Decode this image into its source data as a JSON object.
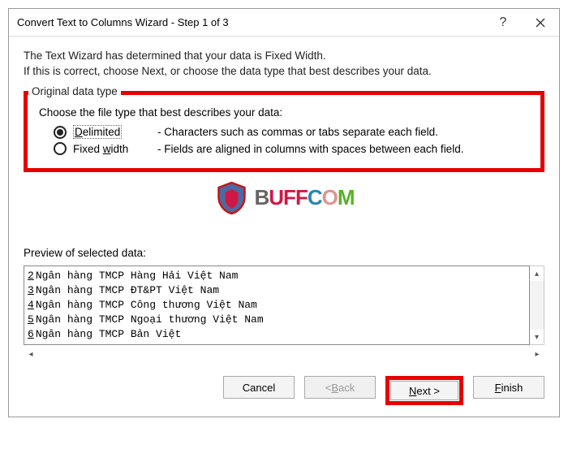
{
  "title": "Convert Text to Columns Wizard - Step 1 of 3",
  "desc1": "The Text Wizard has determined that your data is Fixed Width.",
  "desc2": "If this is correct, choose Next, or choose the data type that best describes your data.",
  "fieldset_label": "Original data type",
  "choose_line": "Choose the file type that best describes your data:",
  "delimited": {
    "label_pre": "D",
    "label_post": "elimited",
    "desc": "- Characters such as commas or tabs separate each field."
  },
  "fixedwidth": {
    "label_pre": "Fixed ",
    "label_u": "w",
    "label_post": "idth",
    "desc": "- Fields are aligned in columns with spaces between each field."
  },
  "preview_label": "Preview of selected data:",
  "preview_rows": [
    {
      "n": "2",
      "t": "Ngân hàng TMCP Hàng Hải Việt Nam"
    },
    {
      "n": "3",
      "t": "Ngân hàng TMCP ĐT&PT Việt Nam"
    },
    {
      "n": "4",
      "t": "Ngân hàng TMCP Công thương Việt Nam"
    },
    {
      "n": "5",
      "t": "Ngân hàng TMCP Ngoại thương Việt Nam"
    },
    {
      "n": "6",
      "t": "Ngân hàng TMCP Bản Việt"
    }
  ],
  "buttons": {
    "cancel": "Cancel",
    "back_pre": "< ",
    "back_u": "B",
    "back_post": "ack",
    "next_u": "N",
    "next_post": "ext >",
    "finish_u": "F",
    "finish_post": "inish"
  },
  "watermark": "BUFFCOM"
}
